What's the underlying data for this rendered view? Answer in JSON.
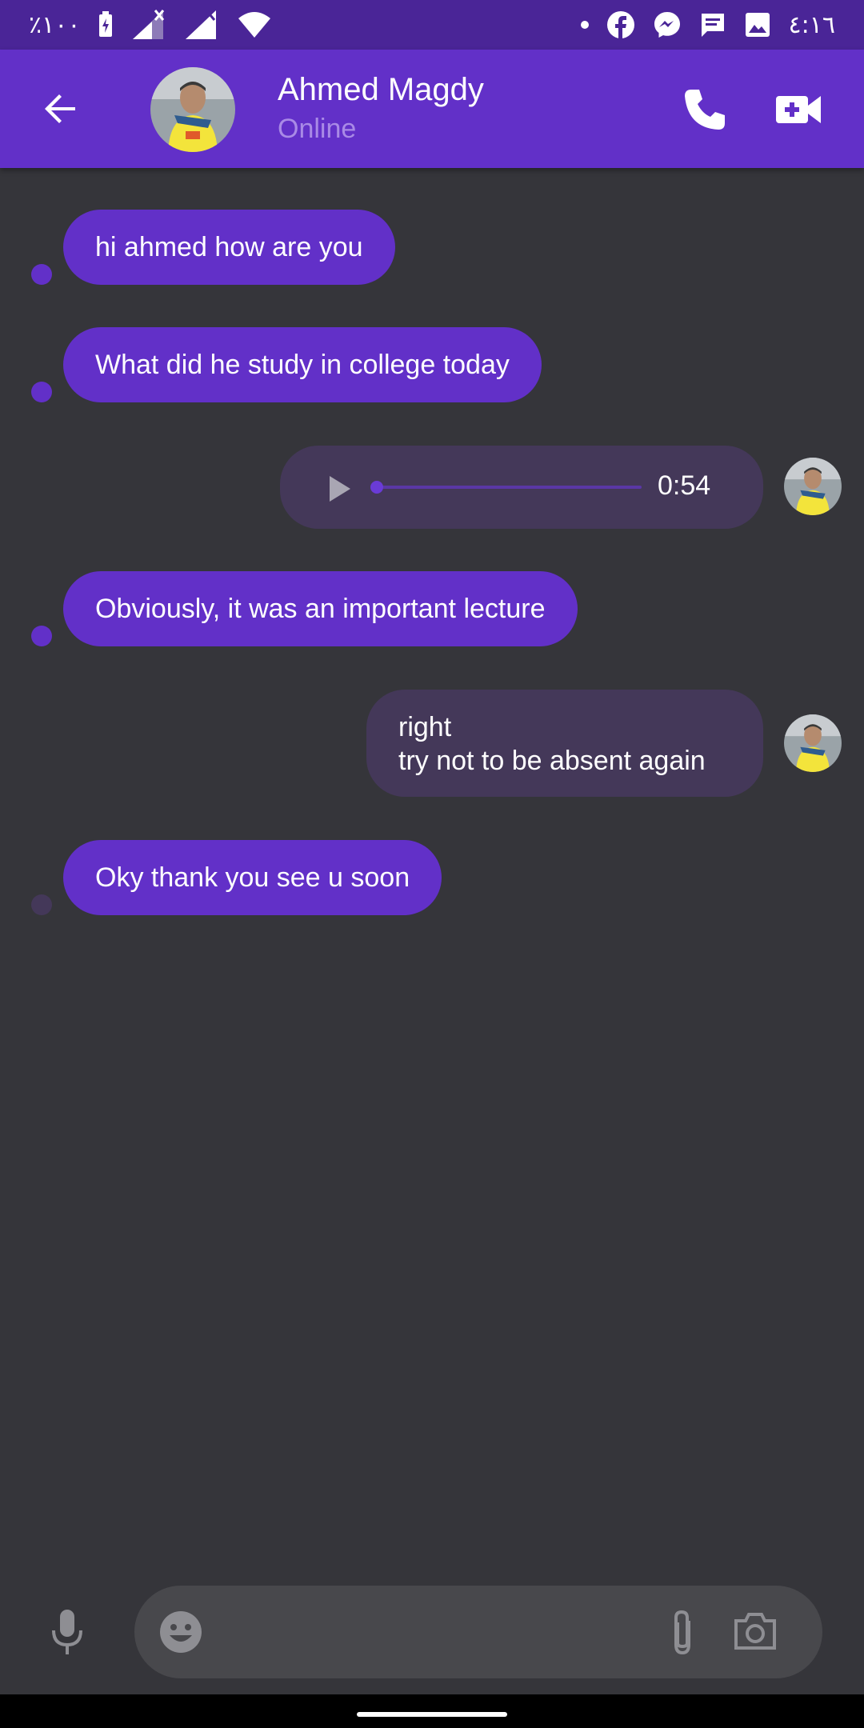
{
  "status_bar": {
    "battery": "٪١٠٠",
    "time": "٤:١٦",
    "icons": [
      "battery-charging-icon",
      "signal-icon",
      "signal-icon",
      "wifi-icon",
      "notification-dot-icon",
      "facebook-icon",
      "messenger-icon",
      "message-icon",
      "image-icon"
    ]
  },
  "header": {
    "contact_name": "Ahmed Magdy",
    "contact_status": "Online",
    "icons": [
      "back-arrow-icon",
      "phone-icon",
      "video-call-icon"
    ]
  },
  "messages": [
    {
      "direction": "in",
      "type": "text",
      "text": "hi ahmed how are you"
    },
    {
      "direction": "in",
      "type": "text",
      "text": "What did he study in college today"
    },
    {
      "direction": "out",
      "type": "audio",
      "duration": "0:54",
      "progress": 0.0
    },
    {
      "direction": "in",
      "type": "text",
      "text": "Obviously, it was an important lecture"
    },
    {
      "direction": "out",
      "type": "text",
      "lines": [
        "right",
        "try not to be absent again"
      ]
    },
    {
      "direction": "in",
      "type": "text",
      "text": "Oky thank you see u soon"
    }
  ],
  "composer": {
    "value": "",
    "icons": [
      "mic-icon",
      "emoji-icon",
      "attach-icon",
      "camera-icon"
    ]
  },
  "colors": {
    "status_bar": "#4a2597",
    "app_bar": "#6230c8",
    "background": "#35353a",
    "incoming_bubble": "#6230c8",
    "outgoing_bubble": "#443859",
    "status_text": "#a98ae6",
    "input_box": "#48484c"
  }
}
